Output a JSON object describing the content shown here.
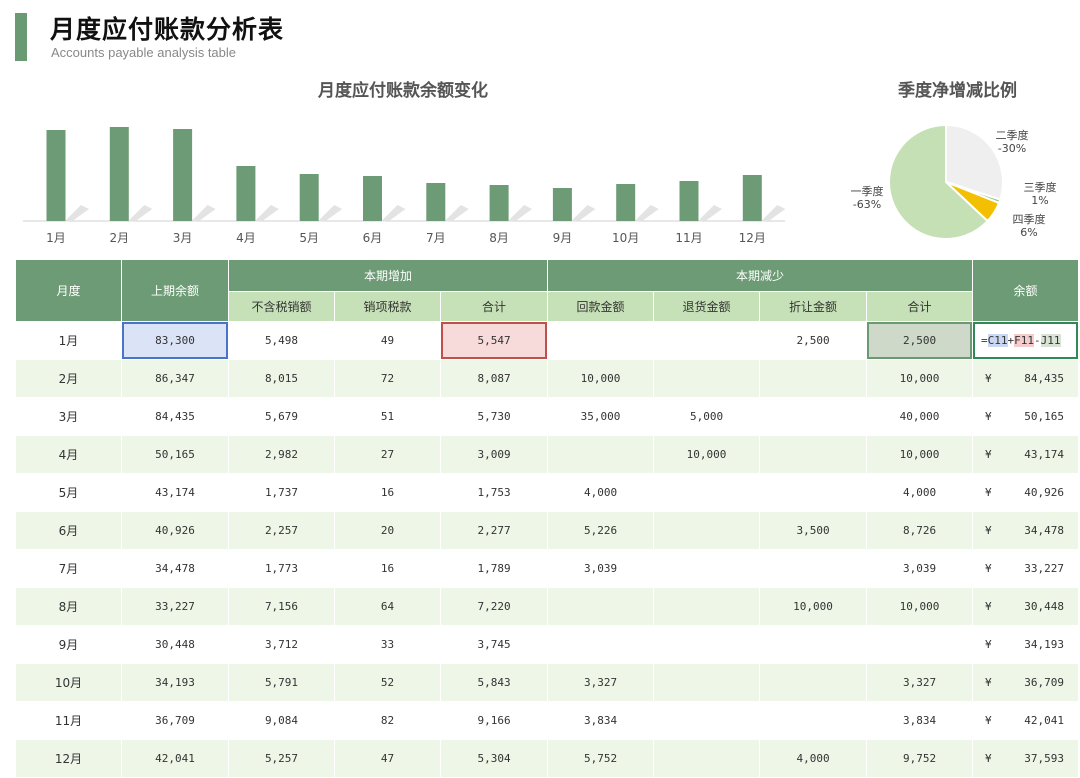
{
  "header": {
    "title": "月度应付账款分析表",
    "subtitle": "Accounts payable analysis table"
  },
  "colors": {
    "accent": "#6a9a73",
    "bar": "#6c9b75",
    "header": "#6c9b75",
    "subheader": "#c6e1b7",
    "row_alt": "#eef6e8"
  },
  "chart_data": [
    {
      "type": "bar",
      "title": "月度应付账款余额变化",
      "categories": [
        "1月",
        "2月",
        "3月",
        "4月",
        "5月",
        "6月",
        "7月",
        "8月",
        "9月",
        "10月",
        "11月",
        "12月"
      ],
      "values": [
        83300,
        86347,
        84435,
        50165,
        43174,
        40926,
        34478,
        33227,
        30448,
        34193,
        36709,
        42041
      ],
      "note_values": "bar heights estimated"
    },
    {
      "type": "pie",
      "title": "季度净增减比例",
      "slices": [
        {
          "name": "一季度",
          "label": "-63%",
          "value": 63,
          "color": "#c5e0b4"
        },
        {
          "name": "二季度",
          "label": "-30%",
          "value": 30,
          "color": "#efefef"
        },
        {
          "name": "三季度",
          "label": "1%",
          "value": 1,
          "color": "#8fc77e"
        },
        {
          "name": "四季度",
          "label": "6%",
          "value": 6,
          "color": "#f2c000"
        }
      ]
    }
  ],
  "table": {
    "headers": {
      "month": "月度",
      "prev_balance": "上期余额",
      "increase_group": "本期增加",
      "decrease_group": "本期减少",
      "balance": "余额",
      "sub": [
        "不含税销额",
        "销项税款",
        "合计",
        "回款金额",
        "退货金额",
        "折让金额",
        "合计"
      ]
    },
    "rows": [
      {
        "month": "1月",
        "prev": "83,300",
        "ex": "5,498",
        "tax": "49",
        "inc": "5,547",
        "ret": "",
        "back": "",
        "disc": "2,500",
        "dec": "2,500",
        "cur": "",
        "bal": ""
      },
      {
        "month": "2月",
        "prev": "86,347",
        "ex": "8,015",
        "tax": "72",
        "inc": "8,087",
        "ret": "10,000",
        "back": "",
        "disc": "",
        "dec": "10,000",
        "cur": "¥",
        "bal": "84,435"
      },
      {
        "month": "3月",
        "prev": "84,435",
        "ex": "5,679",
        "tax": "51",
        "inc": "5,730",
        "ret": "35,000",
        "back": "5,000",
        "disc": "",
        "dec": "40,000",
        "cur": "¥",
        "bal": "50,165"
      },
      {
        "month": "4月",
        "prev": "50,165",
        "ex": "2,982",
        "tax": "27",
        "inc": "3,009",
        "ret": "",
        "back": "10,000",
        "disc": "",
        "dec": "10,000",
        "cur": "¥",
        "bal": "43,174"
      },
      {
        "month": "5月",
        "prev": "43,174",
        "ex": "1,737",
        "tax": "16",
        "inc": "1,753",
        "ret": "4,000",
        "back": "",
        "disc": "",
        "dec": "4,000",
        "cur": "¥",
        "bal": "40,926"
      },
      {
        "month": "6月",
        "prev": "40,926",
        "ex": "2,257",
        "tax": "20",
        "inc": "2,277",
        "ret": "5,226",
        "back": "",
        "disc": "3,500",
        "dec": "8,726",
        "cur": "¥",
        "bal": "34,478"
      },
      {
        "month": "7月",
        "prev": "34,478",
        "ex": "1,773",
        "tax": "16",
        "inc": "1,789",
        "ret": "3,039",
        "back": "",
        "disc": "",
        "dec": "3,039",
        "cur": "¥",
        "bal": "33,227"
      },
      {
        "month": "8月",
        "prev": "33,227",
        "ex": "7,156",
        "tax": "64",
        "inc": "7,220",
        "ret": "",
        "back": "",
        "disc": "10,000",
        "dec": "10,000",
        "cur": "¥",
        "bal": "30,448"
      },
      {
        "month": "9月",
        "prev": "30,448",
        "ex": "3,712",
        "tax": "33",
        "inc": "3,745",
        "ret": "",
        "back": "",
        "disc": "",
        "dec": "",
        "cur": "¥",
        "bal": "34,193"
      },
      {
        "month": "10月",
        "prev": "34,193",
        "ex": "5,791",
        "tax": "52",
        "inc": "5,843",
        "ret": "3,327",
        "back": "",
        "disc": "",
        "dec": "3,327",
        "cur": "¥",
        "bal": "36,709"
      },
      {
        "month": "11月",
        "prev": "36,709",
        "ex": "9,084",
        "tax": "82",
        "inc": "9,166",
        "ret": "3,834",
        "back": "",
        "disc": "",
        "dec": "3,834",
        "cur": "¥",
        "bal": "42,041"
      },
      {
        "month": "12月",
        "prev": "42,041",
        "ex": "5,257",
        "tax": "47",
        "inc": "5,304",
        "ret": "5,752",
        "back": "",
        "disc": "4,000",
        "dec": "9,752",
        "cur": "¥",
        "bal": "37,593"
      }
    ],
    "formula": {
      "eq": "=",
      "a": "C11",
      "plus": "+",
      "b": "F11",
      "minus": "-",
      "c": "J11"
    }
  }
}
